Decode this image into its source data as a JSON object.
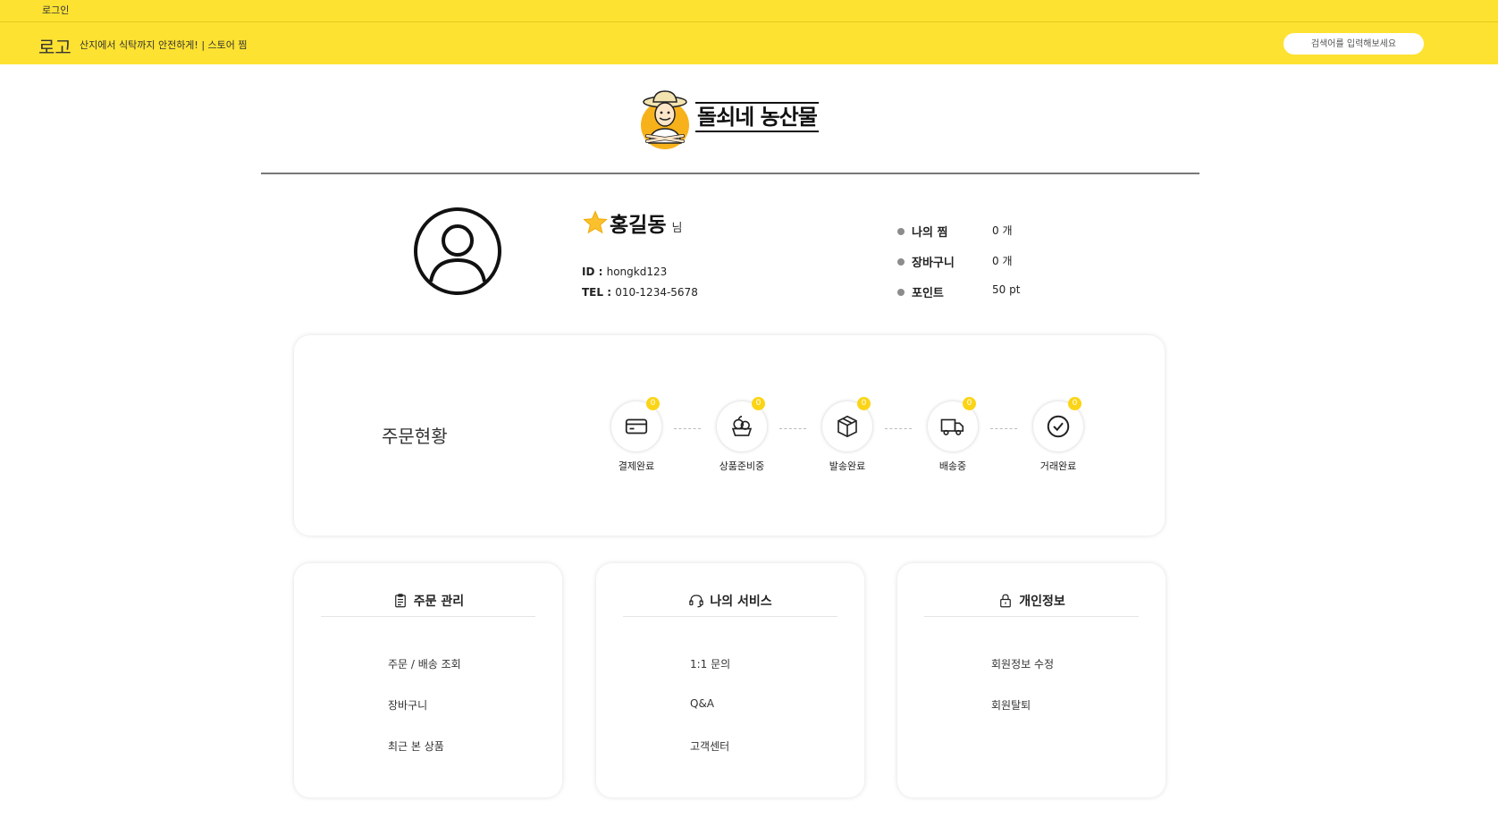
{
  "header": {
    "login_label": "로그인",
    "logo_text": "로고",
    "slogan": "산지에서 식탁까지 안전하게! | 스토어 찜",
    "search_placeholder": "검색어를 입력해보세요",
    "background_color": "#fde232"
  },
  "brand": {
    "name": "돌쇠네 농산물",
    "mascot_icon": "farmer-mascot-icon"
  },
  "profile": {
    "avatar_icon": "user-avatar-icon",
    "badge_icon": "star-icon",
    "name": "홍길동",
    "name_suffix": "님",
    "id_label": "ID : ",
    "id_value": "hongkd123",
    "tel_label": "TEL : ",
    "tel_value": "010-1234-5678"
  },
  "stats": [
    {
      "label": "나의 찜",
      "value": "0 개"
    },
    {
      "label": "장바구니",
      "value": "0 개"
    },
    {
      "label": "포인트",
      "value": "50 pt"
    }
  ],
  "order_status": {
    "title": "주문현황",
    "steps": [
      {
        "label": "결제완료",
        "count": "0",
        "icon": "credit-card-icon"
      },
      {
        "label": "상품준비중",
        "count": "0",
        "icon": "produce-basket-icon"
      },
      {
        "label": "발송완료",
        "count": "0",
        "icon": "package-box-icon"
      },
      {
        "label": "배송중",
        "count": "0",
        "icon": "delivery-truck-icon"
      },
      {
        "label": "거래완료",
        "count": "0",
        "icon": "check-circle-icon"
      }
    ],
    "badge_color": "#fbd416"
  },
  "menus": [
    {
      "title": "주문 관리",
      "icon": "clipboard-icon",
      "items": [
        "주문 / 배송 조회",
        "장바구니",
        "최근 본 상품"
      ]
    },
    {
      "title": "나의 서비스",
      "icon": "headset-icon",
      "items": [
        "1:1 문의",
        "Q&A",
        "고객센터"
      ]
    },
    {
      "title": "개인정보",
      "icon": "lock-icon",
      "items": [
        "회원정보 수정",
        "회원탈퇴"
      ]
    }
  ]
}
